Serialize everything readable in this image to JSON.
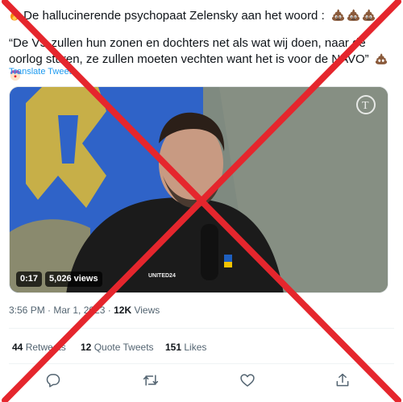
{
  "tweet": {
    "line1_text": "De hallucinerende psychopaat Zelensky aan het woord :",
    "line1_emoji": [
      "pile-of-poo-emoji",
      "pile-of-poo-emoji",
      "pile-of-poo-emoji"
    ],
    "quote_text": "“De VS zullen hun zonen en dochters net als wat wij doen, naar de oorlog sturen, ze zullen moeten vechten want het is voor de NAVO”",
    "translate_label": "Translate Tweet",
    "video": {
      "duration": "0:17",
      "views_label": "5,026 views",
      "watermark": "telegraph-logo-icon",
      "shirt_text": "UNITED24"
    },
    "meta": {
      "time": "3:56 PM",
      "separator": " · ",
      "date": "Mar 1, 2023",
      "dot": " · ",
      "views_count": "12K",
      "views_label": " Views"
    },
    "stats": {
      "retweets_count": "44",
      "retweets_label": "Retweets",
      "quotes_count": "12",
      "quotes_label": "Quote Tweets",
      "likes_count": "151",
      "likes_label": "Likes"
    },
    "actions": [
      "reply-icon",
      "retweet-icon",
      "like-icon",
      "share-icon"
    ]
  },
  "colors": {
    "cross": "#e5262d",
    "link": "#1d9bf0",
    "muted": "#536471",
    "text": "#0f1419"
  }
}
